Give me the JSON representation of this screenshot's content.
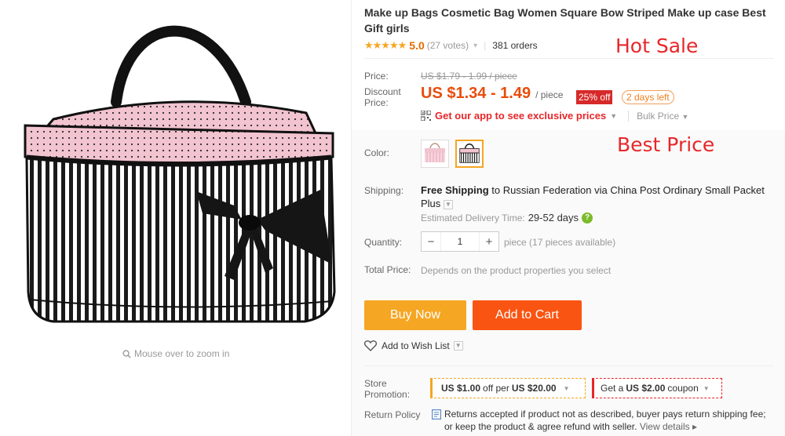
{
  "gallery": {
    "zoom_hint": "Mouse over to zoom in",
    "zoom_icon": "magnifier-icon"
  },
  "product": {
    "title": "Make up Bags Cosmetic Bag Women Square Bow Striped Make up case Best Gift girls",
    "rating": {
      "stars": 5,
      "stars_text": "★★★★★",
      "score": "5.0",
      "votes": "(27 votes)",
      "orders": "381 orders"
    },
    "overlay_hot_sale": "Hot Sale",
    "overlay_best_price": "Best Price",
    "price": {
      "label": "Price:",
      "original": "US $1.79 - 1.99 / piece",
      "discount_label": "Discount Price:",
      "discount": "US $1.34 - 1.49",
      "per": "/ piece",
      "off_badge": "25% off",
      "days_left": "2 days left"
    },
    "app_promo": "Get our app to see exclusive prices",
    "bulk_price": "Bulk Price",
    "color": {
      "label": "Color:",
      "options": [
        "pink-polka-dot",
        "black-white-stripe"
      ],
      "selected_index": 1
    },
    "shipping": {
      "label": "Shipping:",
      "free": "Free Shipping",
      "to": " to ",
      "destination": "Russian Federation",
      "via": " via ",
      "method": "China Post Ordinary Small Packet Plus",
      "delivery_label": "Estimated Delivery Time:",
      "delivery_days": "29-52 days"
    },
    "quantity": {
      "label": "Quantity:",
      "value": "1",
      "minus": "−",
      "plus": "+",
      "note": "piece (17 pieces available)"
    },
    "total": {
      "label": "Total Price:",
      "note": "Depends on the product properties you select"
    },
    "buttons": {
      "buy_now": "Buy Now",
      "add_to_cart": "Add to Cart"
    },
    "wishlist": "Add to Wish List",
    "promotion": {
      "label": "Store Promotion:",
      "coupon1_amount": "US $1.00",
      "coupon1_mid": "off per",
      "coupon1_min": "US $20.00",
      "coupon2_pre": "Get a",
      "coupon2_amount": "US $2.00",
      "coupon2_post": "coupon"
    },
    "return_policy": {
      "label": "Return Policy",
      "text": "Returns accepted if product not as described, buyer pays return shipping fee; or keep the product & agree refund with seller.",
      "link": "View details ▸"
    }
  },
  "colors": {
    "accent_red": "#e8272a",
    "price_orange": "#e84c0c",
    "buy_now": "#f5a623",
    "add_to_cart": "#fa5412",
    "bag_pink": "#f2c4d0"
  }
}
